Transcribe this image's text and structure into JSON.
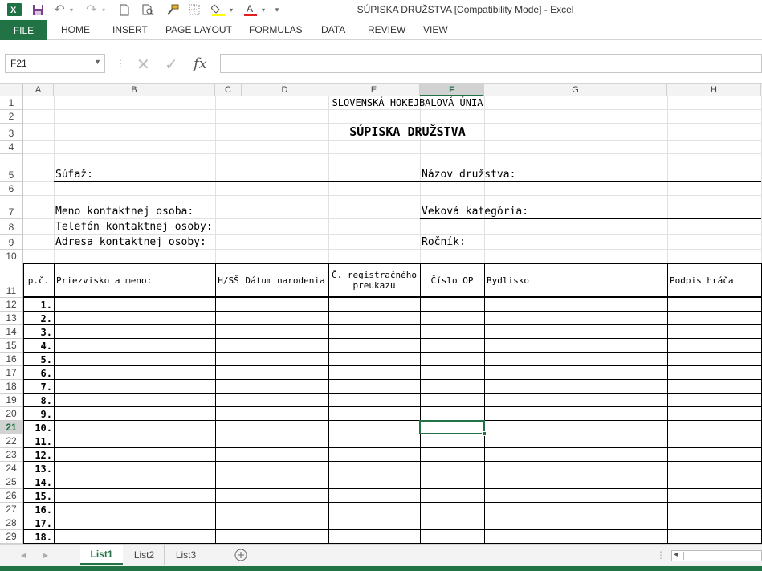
{
  "app": {
    "title": "SÚPISKA DRUŽSTVA  [Compatibility Mode] - Excel"
  },
  "qat": {
    "undo_icon": "↶",
    "redo_icon": "↷",
    "dropdown_icon": "▾"
  },
  "ribbon": {
    "tabs": [
      "FILE",
      "HOME",
      "INSERT",
      "PAGE LAYOUT",
      "FORMULAS",
      "DATA",
      "REVIEW",
      "VIEW"
    ]
  },
  "formula_bar": {
    "name_box": "F21",
    "cancel": "✕",
    "enter": "✓",
    "fx": "fx",
    "value": ""
  },
  "columns": [
    "A",
    "B",
    "C",
    "D",
    "E",
    "F",
    "G",
    "H"
  ],
  "selected_column": "F",
  "rows": [
    "1",
    "2",
    "3",
    "4",
    "5",
    "6",
    "7",
    "8",
    "9",
    "10",
    "11",
    "12",
    "13",
    "14",
    "15",
    "16",
    "17",
    "18",
    "19",
    "20",
    "21",
    "22",
    "23",
    "24",
    "25",
    "26",
    "27",
    "28",
    "29"
  ],
  "selected_row": "21",
  "sheet": {
    "union": "SLOVENSKÁ HOKEJBALOVÁ ÚNIA",
    "title": "SÚPISKA DRUŽSTVA",
    "competition_label": "Súťaž:",
    "team_name_label": "Názov družstva:",
    "contact_name_label": "Meno kontaktnej osoba:",
    "age_category_label": "Veková kategória:",
    "contact_phone_label": "Telefón kontaktnej osoby:",
    "contact_address_label": "Adresa kontaktnej osoby:",
    "year_label": "Ročník:",
    "table_headers": {
      "no": "p.č.",
      "name": "Priezvisko a meno:",
      "hs": "H/SŠ",
      "birth": "Dátum narodenia",
      "reg": "Č. registračného preukazu",
      "id": "Číslo OP",
      "address": "Bydlisko",
      "signature": "Podpis hráča"
    },
    "player_numbers": [
      "1.",
      "2.",
      "3.",
      "4.",
      "5.",
      "6.",
      "7.",
      "8.",
      "9.",
      "10.",
      "11.",
      "12.",
      "13.",
      "14.",
      "15.",
      "16.",
      "17.",
      "18."
    ]
  },
  "sheet_tabs": [
    "List1",
    "List2",
    "List3"
  ],
  "active_sheet": "List1"
}
